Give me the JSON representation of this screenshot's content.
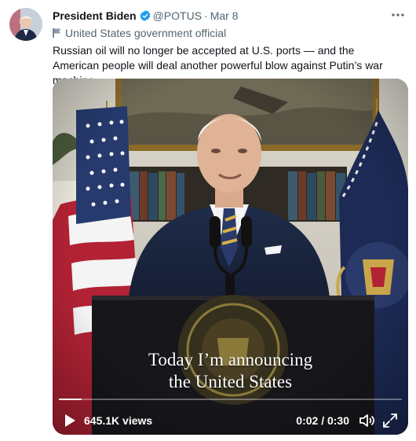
{
  "tweet": {
    "author_name": "President Biden",
    "handle": "@POTUS",
    "separator": "·",
    "date": "Mar 8",
    "affiliation": "United States government official",
    "text": "Russian oil will no longer be accepted at U.S. ports — and the American people will deal another powerful blow against Putin’s war machine."
  },
  "video": {
    "caption_line1": "Today I’m announcing",
    "caption_line2": "the United States",
    "views": "645.1K views",
    "time": "0:02 / 0:30",
    "progress": 0.067
  },
  "colors": {
    "verified": "#1d9bf0",
    "muted": "#536471",
    "text": "#0f1419"
  },
  "icons": [
    "verified-badge-icon",
    "flag-icon",
    "play-icon",
    "volume-icon",
    "fullscreen-icon",
    "more-icon"
  ]
}
